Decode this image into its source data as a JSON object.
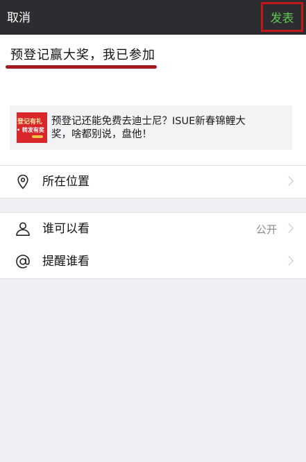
{
  "header": {
    "cancel_label": "取消",
    "publish_label": "发表",
    "publish_color": "#5fc651",
    "highlight_color": "#c4171b"
  },
  "composer": {
    "text": "预登记赢大奖，我已参加"
  },
  "share_card": {
    "thumbnail": {
      "line1": "登记有礼",
      "line2": "• 转发有奖"
    },
    "text": "预登记还能免费去迪士尼？ISUE新春锦鲤大奖，啥都别说，盘他！"
  },
  "rows": {
    "location": {
      "label": "所在位置",
      "icon": "location-pin-icon"
    },
    "visibility": {
      "label": "谁可以看",
      "value": "公开",
      "icon": "person-icon"
    },
    "mention": {
      "label": "提醒谁看",
      "icon": "at-sign-icon"
    }
  }
}
